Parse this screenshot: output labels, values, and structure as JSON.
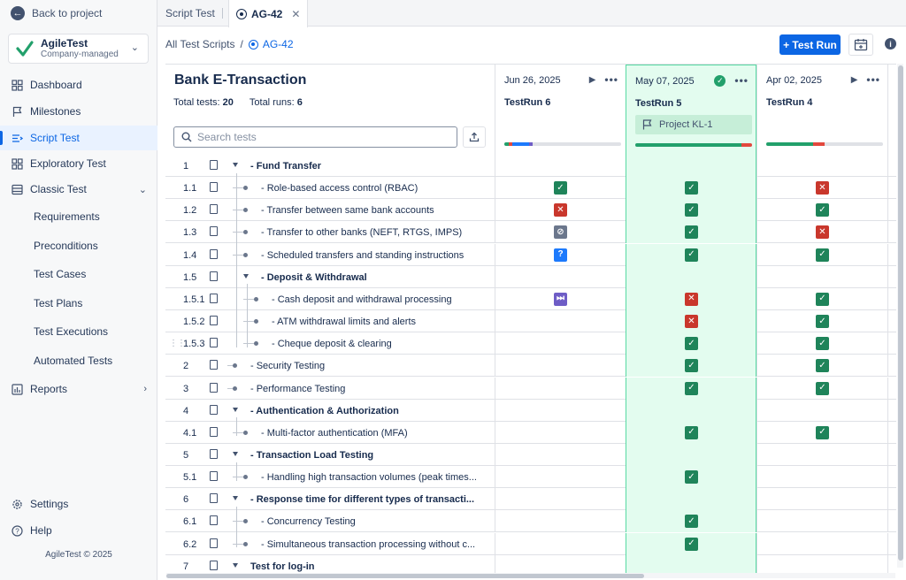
{
  "sidebar": {
    "back_label": "Back to project",
    "project": {
      "name": "AgileTest",
      "type": "Company-managed"
    },
    "items": [
      {
        "label": "Dashboard",
        "icon": "dashboard-icon"
      },
      {
        "label": "Milestones",
        "icon": "flag-icon"
      },
      {
        "label": "Script Test",
        "icon": "script-icon",
        "active": true
      },
      {
        "label": "Exploratory Test",
        "icon": "grid-icon"
      },
      {
        "label": "Classic Test",
        "icon": "list-icon",
        "expanded": true
      }
    ],
    "subitems": [
      "Requirements",
      "Preconditions",
      "Test Cases",
      "Test Plans",
      "Test Executions",
      "Automated Tests"
    ],
    "reports_label": "Reports",
    "settings_label": "Settings",
    "help_label": "Help",
    "footer": "AgileTest © 2025"
  },
  "tabs": [
    {
      "label": "Script Test"
    },
    {
      "label": "AG-42",
      "active": true
    }
  ],
  "breadcrumb": {
    "root": "All Test Scripts",
    "separator": "/",
    "current": "AG-42"
  },
  "toolbar": {
    "run_label": "+ Test Run"
  },
  "script": {
    "title": "Bank E-Transaction",
    "total_tests_label": "Total tests:",
    "total_tests": "20",
    "total_runs_label": "Total runs:",
    "total_runs": "6",
    "search_placeholder": "Search tests"
  },
  "runs": [
    {
      "date": "Jun 26, 2025",
      "name": "TestRun 6",
      "highlight": false,
      "progress": [
        {
          "color": "#22a06b",
          "pct": 0.04
        },
        {
          "color": "#e2483d",
          "pct": 0.03
        },
        {
          "color": "#1d7afc",
          "pct": 0.14
        },
        {
          "color": "#6e5dc6",
          "pct": 0.03
        }
      ]
    },
    {
      "date": "May 07, 2025",
      "name": "TestRun 5",
      "highlight": true,
      "project": "Project KL-1",
      "progress": [
        {
          "color": "#22a06b",
          "pct": 0.91
        },
        {
          "color": "#e2483d",
          "pct": 0.09
        }
      ]
    },
    {
      "date": "Apr 02, 2025",
      "name": "TestRun 4",
      "highlight": false,
      "progress": [
        {
          "color": "#22a06b",
          "pct": 0.4
        },
        {
          "color": "#e2483d",
          "pct": 0.1
        }
      ]
    }
  ],
  "rows": [
    {
      "num": "1",
      "label": "- Fund Transfer",
      "bold": true,
      "level": 0,
      "group": true,
      "s": [
        "",
        "",
        ""
      ]
    },
    {
      "num": "1.1",
      "label": "- Role-based access control (RBAC)",
      "level": 1,
      "s": [
        "pass",
        "pass",
        "fail"
      ]
    },
    {
      "num": "1.2",
      "label": "- Transfer between same bank accounts",
      "level": 1,
      "s": [
        "fail",
        "pass",
        "pass"
      ]
    },
    {
      "num": "1.3",
      "label": "- Transfer to other banks (NEFT, RTGS, IMPS)",
      "level": 1,
      "s": [
        "blocked",
        "pass",
        "fail"
      ]
    },
    {
      "num": "1.4",
      "label": "- Scheduled transfers and standing instructions",
      "level": 1,
      "s": [
        "unk",
        "pass",
        "pass"
      ]
    },
    {
      "num": "1.5",
      "label": "- Deposit & Withdrawal",
      "bold": true,
      "level": 1,
      "group": true,
      "s": [
        "",
        "",
        ""
      ]
    },
    {
      "num": "1.5.1",
      "label": "- Cash deposit and withdrawal processing",
      "level": 2,
      "s": [
        "skip",
        "fail",
        "pass"
      ]
    },
    {
      "num": "1.5.2",
      "label": "- ATM withdrawal limits and alerts",
      "level": 2,
      "s": [
        "",
        "fail",
        "pass"
      ]
    },
    {
      "num": "1.5.3",
      "label": "- Cheque deposit & clearing",
      "level": 2,
      "drag": true,
      "s": [
        "",
        "pass",
        "pass"
      ]
    },
    {
      "num": "2",
      "label": "- Security Testing",
      "level": 0,
      "s": [
        "",
        "pass",
        "pass"
      ]
    },
    {
      "num": "3",
      "label": "- Performance Testing",
      "level": 0,
      "s": [
        "",
        "pass",
        "pass"
      ]
    },
    {
      "num": "4",
      "label": "- Authentication & Authorization",
      "bold": true,
      "level": 0,
      "group": true,
      "s": [
        "",
        "",
        ""
      ]
    },
    {
      "num": "4.1",
      "label": "- Multi-factor authentication (MFA)",
      "level": 1,
      "s": [
        "",
        "pass",
        "pass"
      ]
    },
    {
      "num": "5",
      "label": "- Transaction Load Testing",
      "bold": true,
      "level": 0,
      "group": true,
      "s": [
        "",
        "",
        ""
      ]
    },
    {
      "num": "5.1",
      "label": "- Handling high transaction volumes (peak times...",
      "level": 1,
      "s": [
        "",
        "pass",
        ""
      ]
    },
    {
      "num": "6",
      "label": "- Response time for different types of transacti...",
      "bold": true,
      "level": 0,
      "group": true,
      "s": [
        "",
        "",
        ""
      ]
    },
    {
      "num": "6.1",
      "label": "- Concurrency Testing",
      "level": 1,
      "s": [
        "",
        "pass",
        ""
      ]
    },
    {
      "num": "6.2",
      "label": "- Simultaneous transaction processing without c...",
      "level": 1,
      "s": [
        "",
        "pass",
        ""
      ]
    },
    {
      "num": "7",
      "label": "Test for log-in",
      "bold": true,
      "level": 0,
      "group": true,
      "s": [
        "",
        "",
        ""
      ]
    }
  ],
  "status_glyphs": {
    "pass": "✓",
    "fail": "✕",
    "blocked": "⊘",
    "unk": "?",
    "skip": "⏭"
  },
  "colors": {
    "accent": "#0c66e4",
    "pass": "#1f845a",
    "fail": "#c9372c",
    "highlight_bg": "#e3fcef"
  }
}
